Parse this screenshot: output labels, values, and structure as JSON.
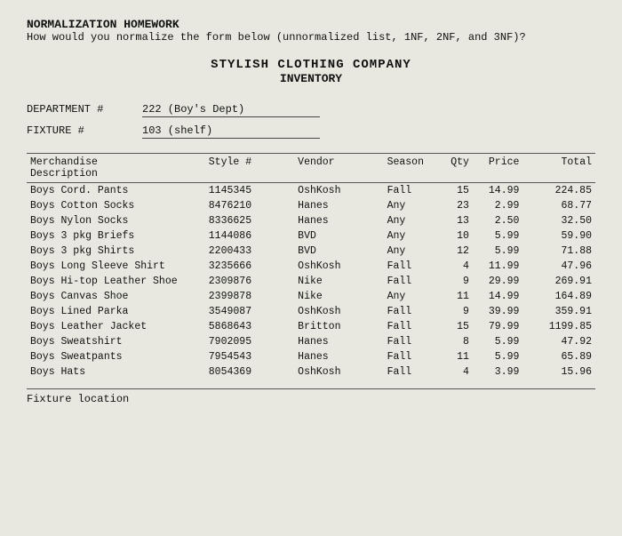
{
  "header": {
    "title": "NORMALIZATION HOMEWORK",
    "subtitle": "How would you normalize the form below (unnormalized list, 1NF, 2NF, and 3NF)?"
  },
  "company": {
    "name": "STYLISH CLOTHING COMPANY",
    "sub": "INVENTORY"
  },
  "dept": {
    "label": "DEPARTMENT #",
    "value": "222 (Boy's Dept)"
  },
  "fixture": {
    "label": "FIXTURE #",
    "value": "103 (shelf)"
  },
  "table": {
    "columns": [
      "Merchandise\nDescription",
      "Style #",
      "Vendor",
      "Season",
      "Qty",
      "Price",
      "Total"
    ],
    "rows": [
      {
        "desc": "Boys Cord. Pants",
        "style": "1145345",
        "vendor": "OshKosh",
        "season": "Fall",
        "qty": "15",
        "price": "14.99",
        "total": "224.85"
      },
      {
        "desc": "Boys Cotton Socks",
        "style": "8476210",
        "vendor": "Hanes",
        "season": "Any",
        "qty": "23",
        "price": "2.99",
        "total": "68.77"
      },
      {
        "desc": "Boys Nylon Socks",
        "style": "8336625",
        "vendor": "Hanes",
        "season": "Any",
        "qty": "13",
        "price": "2.50",
        "total": "32.50"
      },
      {
        "desc": "Boys 3 pkg Briefs",
        "style": "1144086",
        "vendor": "BVD",
        "season": "Any",
        "qty": "10",
        "price": "5.99",
        "total": "59.90"
      },
      {
        "desc": "Boys 3 pkg Shirts",
        "style": "2200433",
        "vendor": "BVD",
        "season": "Any",
        "qty": "12",
        "price": "5.99",
        "total": "71.88"
      },
      {
        "desc": "Boys Long Sleeve Shirt",
        "style": "3235666",
        "vendor": "OshKosh",
        "season": "Fall",
        "qty": "4",
        "price": "11.99",
        "total": "47.96"
      },
      {
        "desc": "Boys Hi-top Leather Shoe",
        "style": "2309876",
        "vendor": "Nike",
        "season": "Fall",
        "qty": "9",
        "price": "29.99",
        "total": "269.91"
      },
      {
        "desc": "Boys Canvas Shoe",
        "style": "2399878",
        "vendor": "Nike",
        "season": "Any",
        "qty": "11",
        "price": "14.99",
        "total": "164.89"
      },
      {
        "desc": "Boys Lined Parka",
        "style": "3549087",
        "vendor": "OshKosh",
        "season": "Fall",
        "qty": "9",
        "price": "39.99",
        "total": "359.91"
      },
      {
        "desc": "Boys Leather Jacket",
        "style": "5868643",
        "vendor": "Britton",
        "season": "Fall",
        "qty": "15",
        "price": "79.99",
        "total": "1199.85"
      },
      {
        "desc": "Boys Sweatshirt",
        "style": "7902095",
        "vendor": "Hanes",
        "season": "Fall",
        "qty": "8",
        "price": "5.99",
        "total": "47.92"
      },
      {
        "desc": "Boys Sweatpants",
        "style": "7954543",
        "vendor": "Hanes",
        "season": "Fall",
        "qty": "11",
        "price": "5.99",
        "total": "65.89"
      },
      {
        "desc": "Boys Hats",
        "style": "8054369",
        "vendor": "OshKosh",
        "season": "Fall",
        "qty": "4",
        "price": "3.99",
        "total": "15.96"
      }
    ]
  },
  "fixture_location": {
    "label": "Fixture location"
  }
}
